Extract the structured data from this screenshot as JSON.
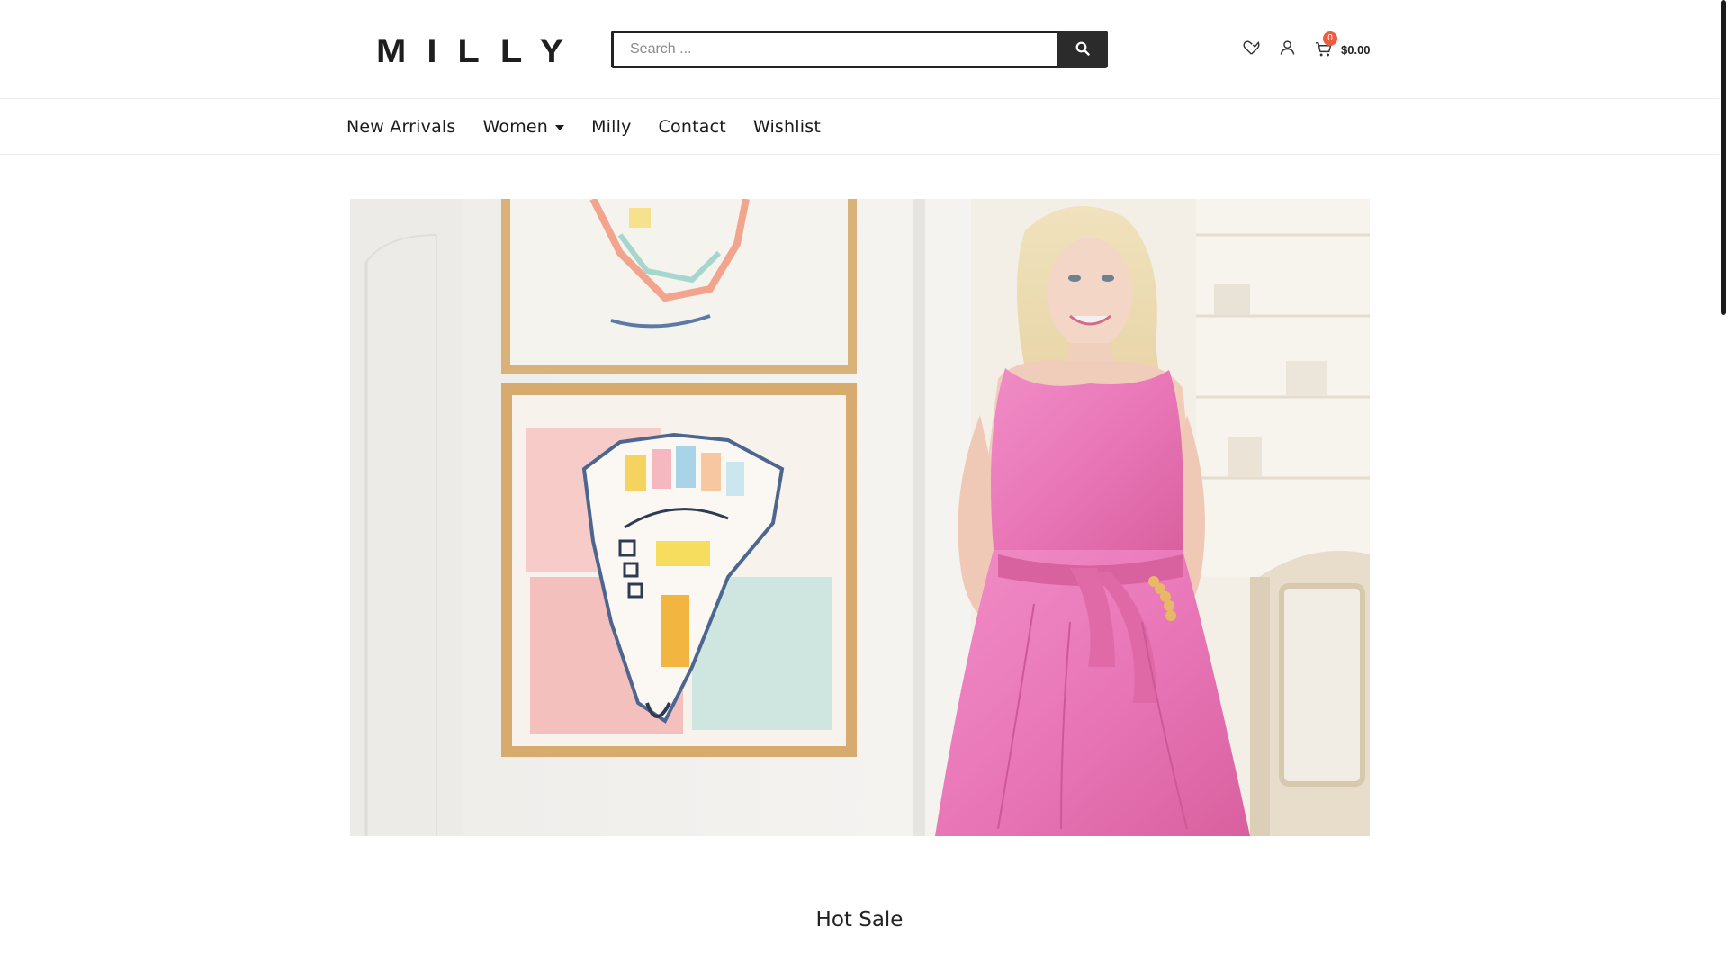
{
  "brand": {
    "logo_text": "MILLY"
  },
  "search": {
    "placeholder": "Search ...",
    "value": ""
  },
  "header": {
    "cart_count": "0",
    "cart_total": "$0.00",
    "icons": [
      "heart-icon",
      "user-icon",
      "cart-icon",
      "search-icon"
    ]
  },
  "nav": {
    "items": [
      {
        "label": "New Arrivals",
        "has_dropdown": false
      },
      {
        "label": "Women",
        "has_dropdown": true
      },
      {
        "label": "Milly",
        "has_dropdown": false
      },
      {
        "label": "Contact",
        "has_dropdown": false
      },
      {
        "label": "Wishlist",
        "has_dropdown": false
      }
    ]
  },
  "hero": {
    "description": "Banner photo"
  },
  "section": {
    "title": "Hot Sale"
  },
  "colors": {
    "accent_badge": "#ef5b3f",
    "search_button": "#2b2b2b",
    "dress_pink": "#ea7cbb",
    "text": "#1b1b1b"
  }
}
